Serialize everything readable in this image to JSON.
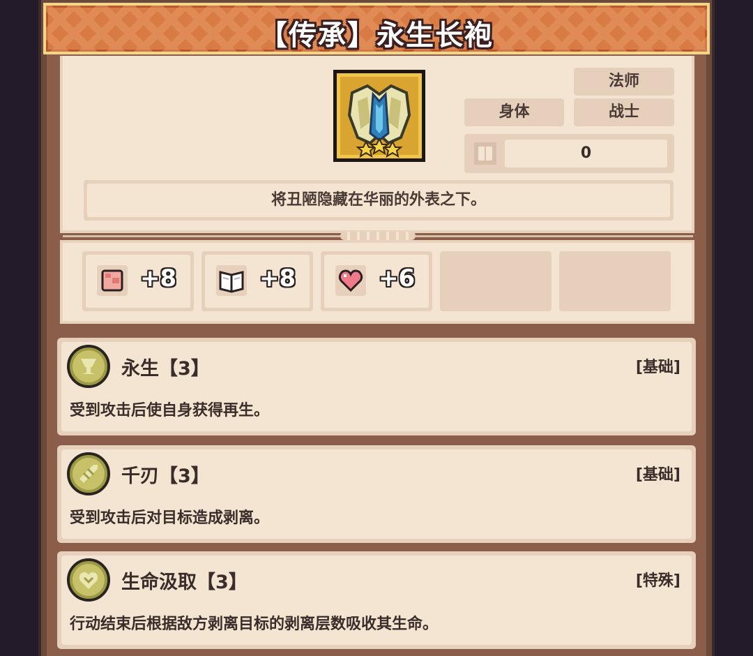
{
  "title": "【传承】永生长袍",
  "item": {
    "icon": "robe-icon",
    "stars": 3,
    "tags": {
      "mage": "法师",
      "body": "身体",
      "warrior": "战士"
    },
    "count": "0",
    "description": "将丑陋隐藏在华丽的外表之下。"
  },
  "stats": [
    {
      "icon": "fist-icon",
      "value": "+8"
    },
    {
      "icon": "book-icon",
      "value": "+8"
    },
    {
      "icon": "heart-icon",
      "value": "+6"
    }
  ],
  "skills": [
    {
      "icon": "goblet-icon",
      "name": "永生【3】",
      "type": "[基础]",
      "desc": "受到攻击后使自身获得再生。"
    },
    {
      "icon": "blades-icon",
      "name": "千刃【3】",
      "type": "[基础]",
      "desc": "受到攻击后对目标造成剥离。"
    },
    {
      "icon": "heart-drain-icon",
      "name": "生命汲取【3】",
      "type": "[特殊]",
      "desc": "行动结束后根据敌方剥离目标的剥离层数吸收其生命。"
    }
  ],
  "colors": {
    "banner": "#d97b45",
    "panel": "#f4e5d3",
    "tag": "#e6d0bb",
    "medal": "#c7c26a"
  }
}
